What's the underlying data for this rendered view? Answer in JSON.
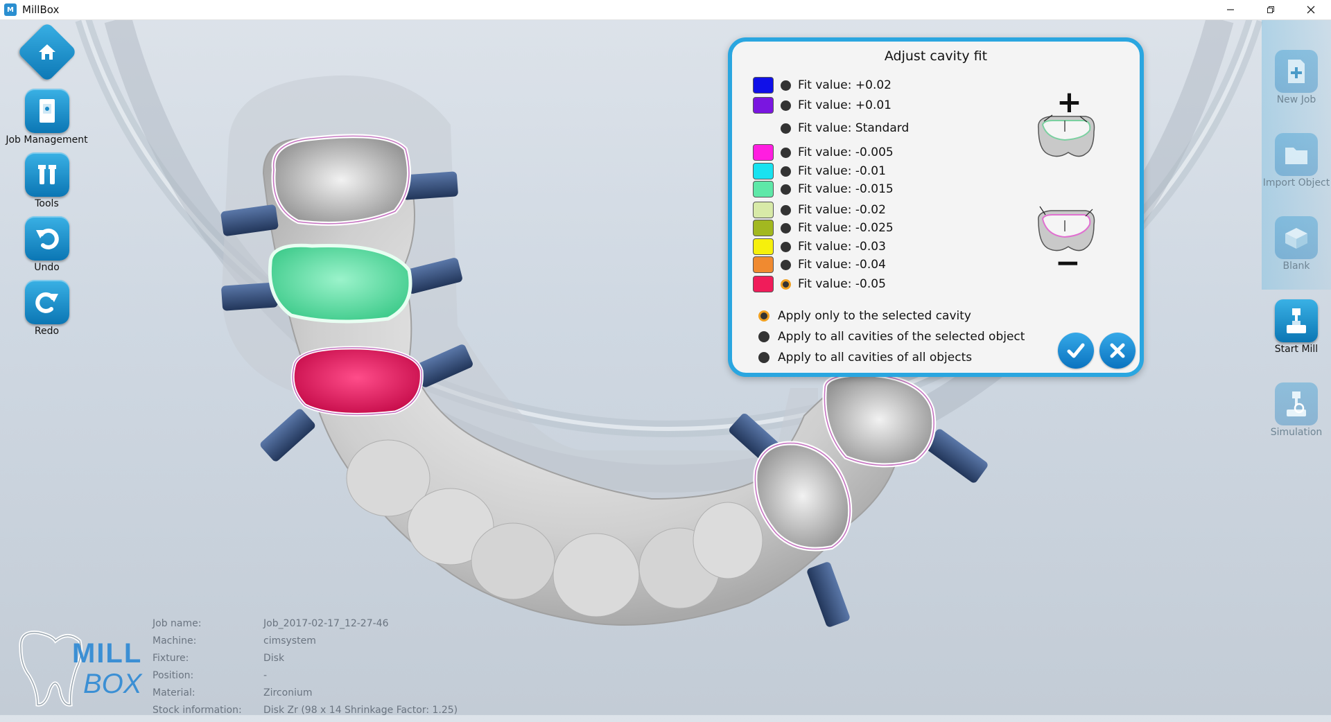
{
  "window": {
    "title": "MillBox",
    "icon": "millbox-app-icon",
    "controls": [
      "minimize-icon",
      "restore-icon",
      "close-icon"
    ]
  },
  "left_toolbar": {
    "items": [
      {
        "label": "",
        "icon": "home-icon"
      },
      {
        "label": "Job Management",
        "icon": "job-management-icon"
      },
      {
        "label": "Tools",
        "icon": "tools-icon"
      },
      {
        "label": "Undo",
        "icon": "undo-icon"
      },
      {
        "label": "Redo",
        "icon": "redo-icon"
      }
    ]
  },
  "right_toolbar": {
    "items": [
      {
        "label": "New Job",
        "icon": "new-job-icon",
        "enabled": false
      },
      {
        "label": "Import Object",
        "icon": "import-object-icon",
        "enabled": false
      },
      {
        "label": "Blank",
        "icon": "blank-icon",
        "enabled": false
      },
      {
        "label": "Start Mill",
        "icon": "start-mill-icon",
        "enabled": true
      },
      {
        "label": "Simulation",
        "icon": "simulation-icon",
        "enabled": false
      }
    ]
  },
  "dialog": {
    "title": "Adjust cavity fit",
    "fit_values": [
      {
        "label": "Fit value: +0.02",
        "color": "#1010e8",
        "selected": false
      },
      {
        "label": "Fit value: +0.01",
        "color": "#7a16e0",
        "selected": false
      },
      {
        "label": "Fit value: Standard",
        "color": "",
        "selected": false
      },
      {
        "label": "Fit value: -0.005",
        "color": "#ff1ee0",
        "selected": false
      },
      {
        "label": "Fit value: -0.01",
        "color": "#18e2f0",
        "selected": false
      },
      {
        "label": "Fit value: -0.015",
        "color": "#5ee8a8",
        "selected": false
      },
      {
        "label": "Fit value: -0.02",
        "color": "#d8eaa8",
        "selected": false
      },
      {
        "label": "Fit value: -0.025",
        "color": "#a2b820",
        "selected": false
      },
      {
        "label": "Fit value: -0.03",
        "color": "#f6f00c",
        "selected": false
      },
      {
        "label": "Fit value: -0.04",
        "color": "#f08a30",
        "selected": false
      },
      {
        "label": "Fit value: -0.05",
        "color": "#f01c5a",
        "selected": true
      }
    ],
    "apply_options": [
      {
        "label": "Apply only to the selected cavity",
        "selected": true
      },
      {
        "label": "Apply to all cavities of the selected object",
        "selected": false
      },
      {
        "label": "Apply to all cavities of all objects",
        "selected": false
      }
    ],
    "plus_symbol": "+",
    "minus_symbol": "−",
    "confirm_icon": "check-icon",
    "cancel_icon": "close-icon"
  },
  "job_info": {
    "rows": [
      {
        "key": "Job name:",
        "value": "Job_2017-02-17_12-27-46"
      },
      {
        "key": "Machine:",
        "value": "cimsystem"
      },
      {
        "key": "Fixture:",
        "value": "Disk"
      },
      {
        "key": "Position:",
        "value": "-"
      },
      {
        "key": "Material:",
        "value": "Zirconium"
      },
      {
        "key": "Stock information:",
        "value": "Disk Zr (98 x 14 Shrinkage Factor: 1.25)"
      }
    ]
  },
  "logo": {
    "text_top": "MILL",
    "text_bottom": "BOX"
  },
  "colors": {
    "accent": "#2aa6e0",
    "button_blue": "#0b76b4",
    "selected_cavity": "#e8105a",
    "green_cavity": "#5ee8a8"
  }
}
